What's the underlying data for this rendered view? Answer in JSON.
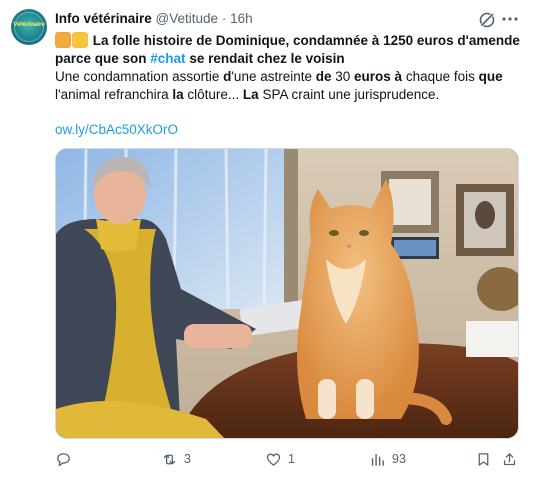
{
  "tweet": {
    "avatar_text": "Vétérinaire",
    "author_name": "Info vétérinaire",
    "handle": "@Vetitude",
    "separator": "·",
    "time": "16h",
    "body": {
      "line1_text": "La folle histoire de Dominique, condamnée à 1250 euros d'amende",
      "line2_pre": "parce que son ",
      "line2_hashtag": "#chat",
      "line2_post": " se rendait chez le voisin",
      "line3_a": "Une condamnation assortie ",
      "line3_b": "d",
      "line3_c": "'une astreinte ",
      "line3_d": "de",
      "line3_e": " 30 ",
      "line3_f": "euros à",
      "line3_g": " chaque fois ",
      "line3_h": "que",
      "line4_a": "l'animal refranchira ",
      "line4_b": "la",
      "line4_c": " clôture... ",
      "line4_d": "La",
      "line4_e": " SPA craint une jurisprudence."
    },
    "link": "ow.ly/CbAc50XkOrO",
    "media_description_icon": "photo-woman-with-orange-cat",
    "actions": {
      "reply_count": "",
      "retweet_count": "3",
      "like_count": "1",
      "views_count": "93"
    },
    "icons": {
      "grok": "grok-icon",
      "more": "more-icon",
      "reply": "reply-icon",
      "retweet": "retweet-icon",
      "like": "heart-icon",
      "views": "views-icon",
      "bookmark": "bookmark-icon",
      "share": "share-icon"
    },
    "colors": {
      "text": "#0f1419",
      "secondary": "#536471",
      "link": "#1d9bf0"
    }
  }
}
